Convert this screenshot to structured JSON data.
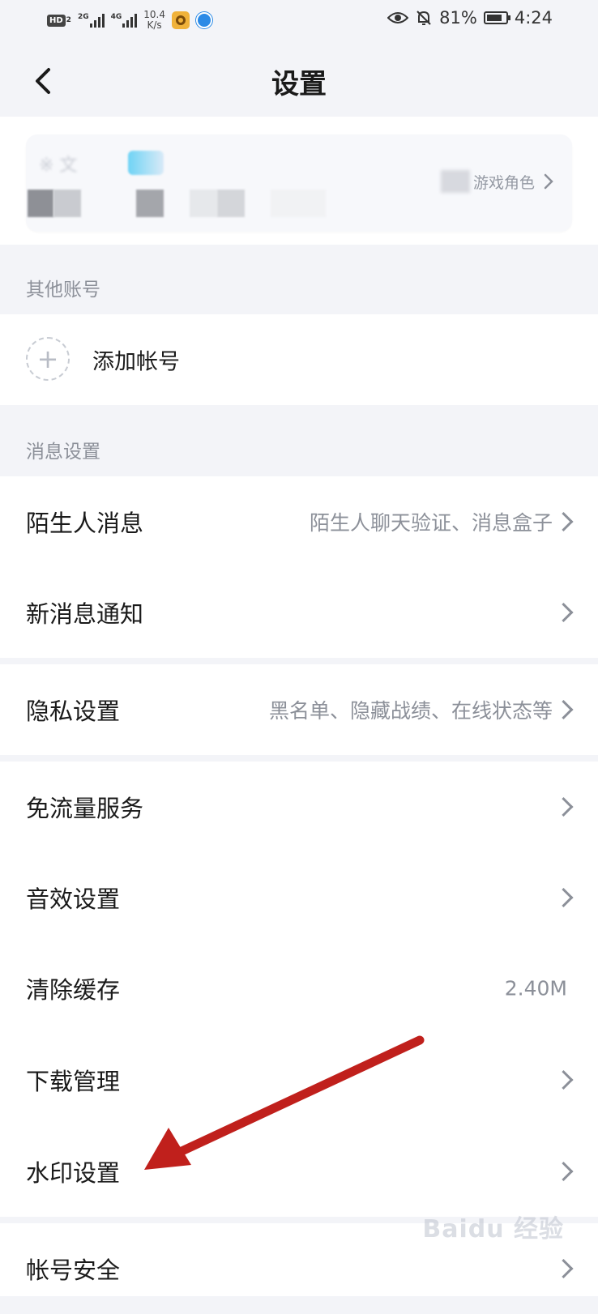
{
  "status_bar": {
    "hd": "HD",
    "hd_sub": "2",
    "net1": "2G",
    "net2": "4G",
    "speed_value": "10.4",
    "speed_unit": "K/s",
    "battery": "81%",
    "time": "4:24",
    "battery_level": 0.81
  },
  "header": {
    "title": "设置"
  },
  "account": {
    "name_blurred": "※ 文",
    "game_role": "游戏角色"
  },
  "sections": {
    "other_accounts": "其他账号",
    "message_settings": "消息设置"
  },
  "add_account": {
    "label": "添加帐号"
  },
  "rows": {
    "stranger": {
      "label": "陌生人消息",
      "value": "陌生人聊天验证、消息盒子"
    },
    "new_msg": {
      "label": "新消息通知"
    },
    "privacy": {
      "label": "隐私设置",
      "value": "黑名单、隐藏战绩、在线状态等"
    },
    "free_data": {
      "label": "免流量服务"
    },
    "sound": {
      "label": "音效设置"
    },
    "cache": {
      "label": "清除缓存",
      "value": "2.40M"
    },
    "download": {
      "label": "下载管理"
    },
    "watermark": {
      "label": "水印设置"
    },
    "security": {
      "label": "帐号安全"
    }
  },
  "watermark_text": "Baidu 经验",
  "colors": {
    "background": "#f3f4f8",
    "panel": "#ffffff",
    "secondary_text": "#8c9099",
    "annotation_arrow": "#c0201c"
  }
}
